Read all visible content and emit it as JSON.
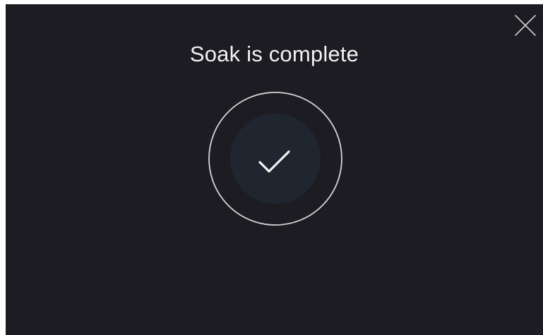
{
  "dialog": {
    "title": "Soak is complete",
    "close_icon": "close-icon",
    "status_icon": "checkmark-icon"
  },
  "colors": {
    "screen_background": "#1c1c22",
    "inner_circle": "#1f2630",
    "ring": "#d6d6d6",
    "text": "#f2f2f2"
  }
}
